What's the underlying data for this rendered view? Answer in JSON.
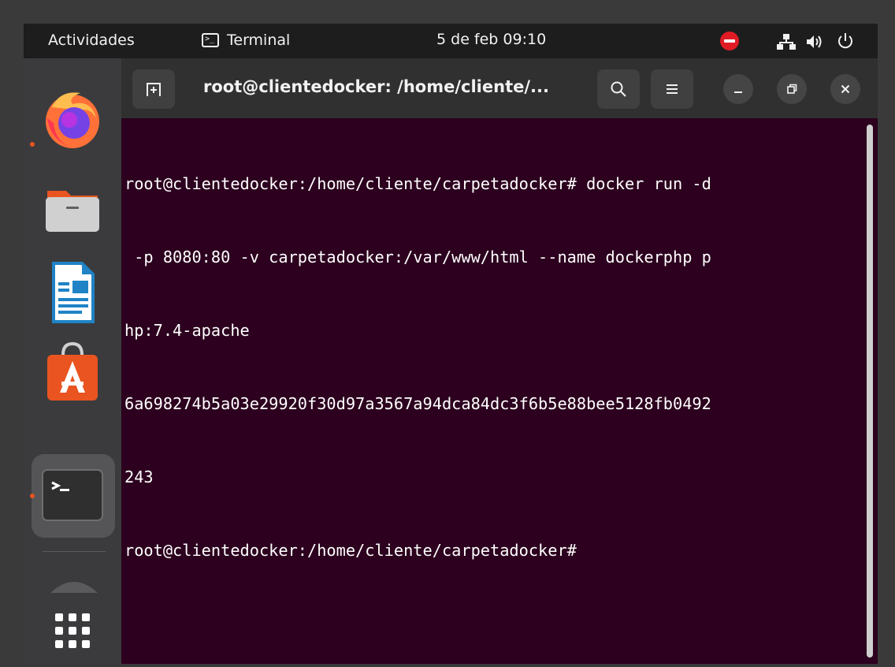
{
  "topbar": {
    "activities_label": "Actividades",
    "app_name": "Terminal",
    "clock": "5 de feb  09:10"
  },
  "dock": {
    "items": [
      {
        "name": "firefox",
        "running": true
      },
      {
        "name": "files",
        "running": false
      },
      {
        "name": "libreoffice-writer",
        "running": false
      },
      {
        "name": "software-center",
        "running": false
      },
      {
        "name": "terminal",
        "running": true,
        "active": true
      }
    ],
    "app_grid_label": "Mostrar aplicaciones"
  },
  "window": {
    "title": "root@clientedocker: /home/cliente/...",
    "terminal_lines": [
      "root@clientedocker:/home/cliente/carpetadocker# docker run -d",
      " -p 8080:80 -v carpetadocker:/var/www/html --name dockerphp p",
      "hp:7.4-apache",
      "6a698274b5a03e29920f30d97a3567a94dca84dc3f6b5e88bee5128fb0492",
      "243",
      "root@clientedocker:/home/cliente/carpetadocker#"
    ]
  },
  "colors": {
    "terminal_bg": "#2c001e",
    "accent": "#e95420",
    "dnd_red": "#e01b24"
  }
}
